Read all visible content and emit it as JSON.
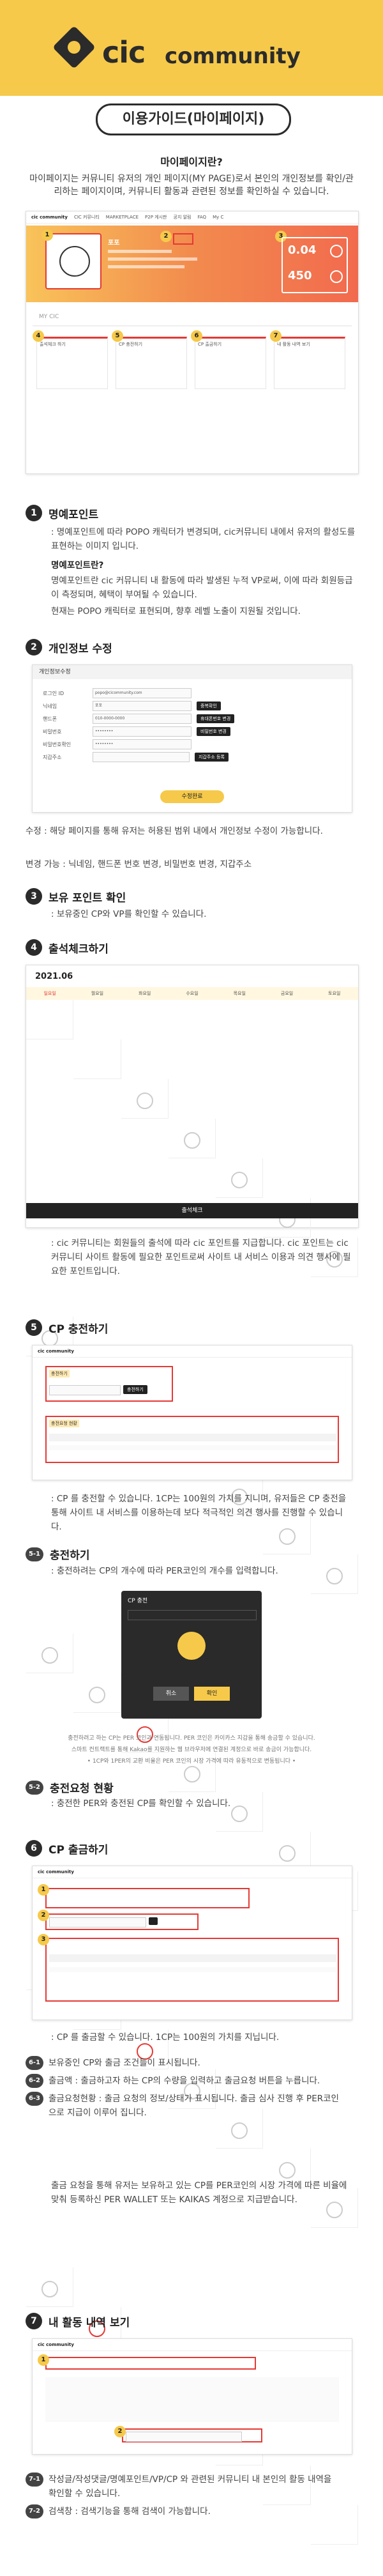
{
  "header": {
    "logo_text": "cic",
    "logo_word": "community",
    "page_title": "이용가이드(마이페이지)"
  },
  "intro": {
    "heading": "마이페이지란?",
    "text": "마이페이지는 커뮤니티 유저의 개인 페이지(MY PAGE)로서 본인의 개인정보를 확인/관리하는 페이지이며, 커뮤니티 활동과 관련된 정보를 확인하실 수 있습니다."
  },
  "shot1": {
    "nav_logo": "cic community",
    "nav_items": [
      "CIC 커뮤니티",
      "MARKETPLACE",
      "P2P 게시판",
      "공지 알림",
      "FAQ",
      "My C"
    ],
    "username": "포포",
    "points": [
      "0.04",
      "450"
    ],
    "section_label": "MY CIC",
    "cards": [
      "출석체크 하기",
      "CP 충전하기",
      "CP 출금하기",
      "내 활동 내역 보기"
    ]
  },
  "sec1": {
    "num": "1",
    "title": "명예포인트",
    "line1": ": 명예포인트에 따라 POPO 캐릭터가 변경되며, cic커뮤니티 내에서 유저의 활성도를 표현하는 이미지 입니다.",
    "subhead": "명예포인트란?",
    "line2": "명예포인트란 cic 커뮤니티 내 활동에 따라 발생된 누적 VP로써, 이에 따라 회원등급이 측정되며, 혜택이 부여될 수 있습니다.",
    "line3": "현재는 POPO 캐릭터로 표현되며, 향후 레벨 노출이 지원될 것입니다."
  },
  "sec2": {
    "num": "2",
    "title": "개인정보 수정",
    "form_title": "개인정보수정",
    "fields": [
      "로그인 ID",
      "닉네임",
      "핸드폰",
      "비밀번호",
      "비밀번호확인",
      "지갑주소"
    ],
    "values": [
      "popo@cicommunity.com",
      "포포",
      "010-0000-0000",
      "••••••••",
      "••••••••",
      ""
    ],
    "buttons": [
      "중복확인",
      "휴대폰번호 변경",
      "비밀번호 변경",
      "지갑주소 등록"
    ],
    "submit": "수정완료",
    "desc1": "수정 : 해당 페이지를 통해 유저는 허용된 범위 내에서 개인정보 수정이 가능합니다.",
    "desc2": "변경 가능 : 닉네임, 핸드폰 번호 변경, 비밀번호 변경, 지갑주소"
  },
  "sec3": {
    "num": "3",
    "title": "보유 포인트 확인",
    "desc": ": 보유중인 CP와 VP를 확인할 수 있습니다."
  },
  "sec4": {
    "num": "4",
    "title": "출석체크하기",
    "month": "2021.06",
    "weekdays": [
      "일요일",
      "월요일",
      "화요일",
      "수요일",
      "목요일",
      "금요일",
      "토요일"
    ],
    "button": "출석체크",
    "desc": ": cic 커뮤니티는 회원들의 출석에 따라 cic 포인트를 지급합니다. cic 포인트는 cic 커뮤니티 사이트 활동에 필요한 포인트로써 사이트 내 서비스 이용과 의견 행사에 필요한 포인트입니다."
  },
  "sec5": {
    "num": "5",
    "title": "CP 충전하기",
    "shot_labels": [
      "충전하기",
      "충전요청 현황"
    ],
    "desc": ": CP 를 충전할 수 있습니다. 1CP는 100원의 가치를 지니며, 유저들은 CP 충전을 통해 사이트 내 서비스를 이용하는데 보다 적극적인 의견 행사를 진행할 수 있습니다.",
    "sub1_num": "5-1",
    "sub1_title": "충전하기",
    "sub1_desc": ": 충전하려는 CP의 개수에 따라 PER코인의 개수를 입력합니다.",
    "modal_title": "CP 충전",
    "modal_buttons": [
      "취소",
      "확인"
    ],
    "notes": [
      "충전하려고 하는 CP는 PER 코인과 연동됩니다. PER 코인은 카이카스 지갑을 통해 송금할 수 있습니다.",
      "스마트 컨트랙트를 통해 Kakao를 지원하는 웹 브라우저에 연결된 계정으로 바로 송금이 가능합니다.",
      "• 1CP와 1PER의 교환 비율은 PER 코인의 시장 가격에 따라 유동적으로 변동됩니다 •"
    ],
    "sub2_num": "5-2",
    "sub2_title": "충전요청 현황",
    "sub2_desc": ": 충전한 PER와 충전된 CP를 확인할 수 있습니다."
  },
  "sec6": {
    "num": "6",
    "title": "CP 출금하기",
    "desc": ": CP 를 출금할 수 있습니다. 1CP는 100원의 가치를 지닙니다.",
    "items": [
      {
        "num": "6-1",
        "text": "보유중인 CP와 출금 조건들이 표시됩니다."
      },
      {
        "num": "6-2",
        "text": "출금액 : 출금하고자 하는 CP의 수량을 입력하고 출금요청 버튼을 누릅니다."
      },
      {
        "num": "6-3",
        "text": "출금요청현황 : 출금 요청의 정보/상태가 표시됩니다. 출금 심사 진행 후 PER코인으로 지급이 이루어 집니다."
      }
    ],
    "note": "출금 요청을 통해 유저는 보유하고 있는 CP를 PER코인의 시장 가격에 따른 비율에 맞춰 등록하신 PER WALLET 또는 KAIKAS 계정으로 지급받습니다."
  },
  "sec7": {
    "num": "7",
    "title": "내 활동 내역 보기",
    "items": [
      {
        "num": "7-1",
        "text": "작성글/작성댓글/명예포인트/VP/CP 와 관련된 커뮤니티 내 본인의 활동 내역을 확인할 수 있습니다."
      },
      {
        "num": "7-2",
        "text": "검색창 : 검색기능을 통해 검색이 가능합니다."
      }
    ]
  }
}
